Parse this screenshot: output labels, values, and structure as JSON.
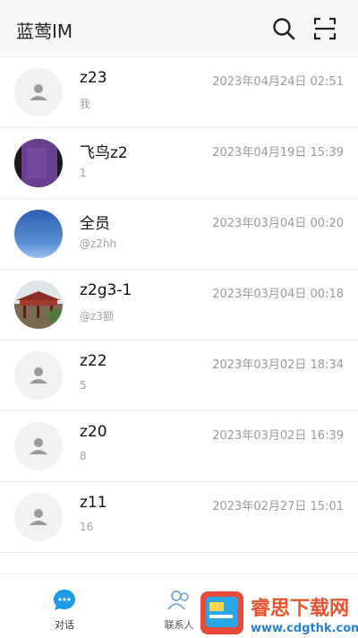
{
  "header": {
    "title": "蓝莺IM"
  },
  "conversations": [
    {
      "name": "z23",
      "time": "2023年04月24日 02:51",
      "preview": "我",
      "avatar": "default"
    },
    {
      "name": "飞鸟z2",
      "time": "2023年04月19日 15:39",
      "preview": "1",
      "avatar": "purple"
    },
    {
      "name": "全员",
      "time": "2023年03月04日 00:20",
      "preview": "@z2hh",
      "avatar": "sky"
    },
    {
      "name": "z2g3-1",
      "time": "2023年03月04日 00:18",
      "preview": "@z3额",
      "avatar": "temple"
    },
    {
      "name": "z22",
      "time": "2023年03月02日 18:34",
      "preview": "5",
      "avatar": "default"
    },
    {
      "name": "z20",
      "time": "2023年03月02日 16:39",
      "preview": "8",
      "avatar": "default"
    },
    {
      "name": "z11",
      "time": "2023年02月27日 15:01",
      "preview": "16",
      "avatar": "default"
    }
  ],
  "tabbar": {
    "chat_label": "对话",
    "contacts_label": "联系人"
  },
  "watermark": {
    "title": "睿思下载网",
    "url": "www.cdgthk.com"
  },
  "colors": {
    "accent": "#1e9be8",
    "header_bg": "#f7f7f7",
    "muted": "#9b9b9b"
  }
}
